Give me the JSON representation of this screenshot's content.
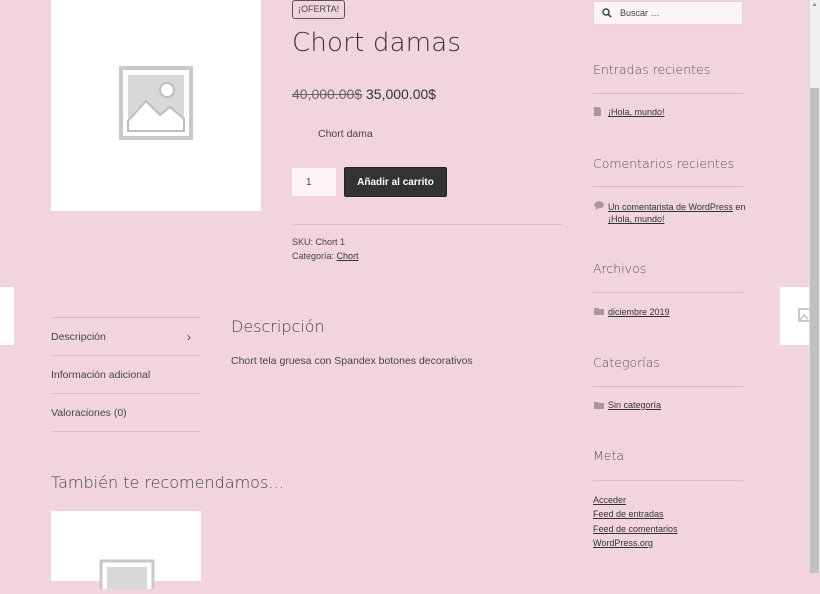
{
  "product": {
    "sale_badge": "¡OFERTA!",
    "title": "Chort damas",
    "old_price": "40,000.00$",
    "new_price": "35,000.00$",
    "short_description": "Chort dama",
    "quantity": "1",
    "add_to_cart_label": "Añadir al carrito",
    "sku_label": "SKU:",
    "sku_value": "Chort 1",
    "category_label": "Categoría:",
    "category_value": "Chort"
  },
  "tabs": [
    {
      "label": "Descripción"
    },
    {
      "label": "Información adicional"
    },
    {
      "label": "Valoraciones (0)"
    }
  ],
  "description": {
    "heading": "Descripción",
    "text": "Chort tela gruesa con Spandex botones decorativos"
  },
  "related": {
    "heading": "También te recomendamos…"
  },
  "sidebar": {
    "search_placeholder": "Buscar …",
    "recent_posts_title": "Entradas recientes",
    "recent_posts": [
      "¡Hola, mundo!"
    ],
    "recent_comments_title": "Comentarios recientes",
    "comment_author": "Un comentarista de WordPress",
    "comment_on": "en",
    "comment_post": "¡Hola, mundo!",
    "archives_title": "Archivos",
    "archives": [
      "diciembre 2019"
    ],
    "categories_title": "Categorías",
    "categories": [
      "Sin categoría"
    ],
    "meta_title": "Meta",
    "meta_links": [
      "Acceder",
      "Feed de entradas",
      "Feed de comentarios",
      "WordPress.org"
    ]
  },
  "colors": {
    "background": "#f2d5dc",
    "button": "#333333",
    "divider": "#e3b9c3"
  },
  "icons": [
    "image-placeholder-icon",
    "chevron-right-icon",
    "search-icon",
    "document-icon",
    "comment-icon",
    "folder-icon"
  ]
}
